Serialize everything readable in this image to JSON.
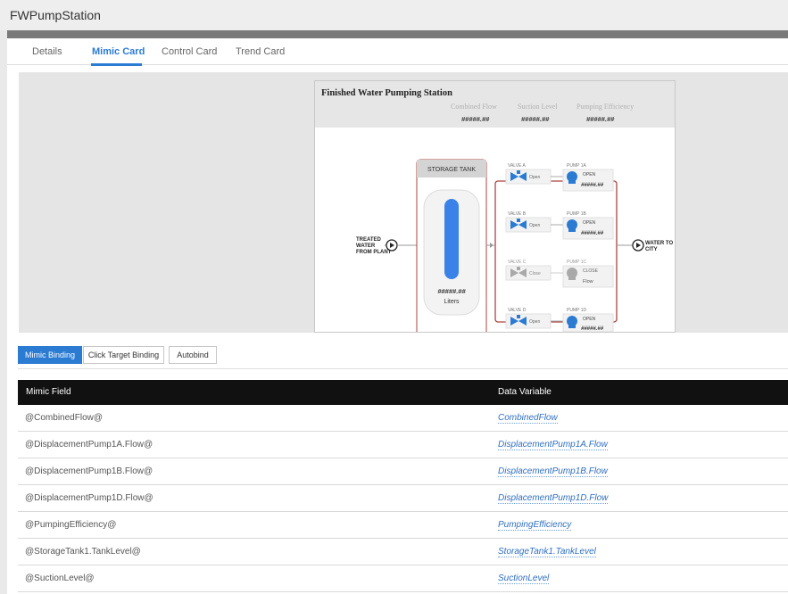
{
  "window": {
    "title": "FWPumpStation"
  },
  "tabs": [
    {
      "label": "Details"
    },
    {
      "label": "Mimic Card"
    },
    {
      "label": "Control Card"
    },
    {
      "label": "Trend Card"
    }
  ],
  "active_tab": "Mimic Card",
  "mimic": {
    "title": "Finished Water Pumping Station",
    "metrics": [
      {
        "label": "Combined Flow",
        "value": "#####.##"
      },
      {
        "label": "Suction Level",
        "value": "#####.##"
      },
      {
        "label": "Pumping Efficiency",
        "value": "#####.##"
      }
    ],
    "tank_label": "STORAGE TANK",
    "tank_value": "#####.##",
    "tank_unit": "Liters",
    "inlet_label": [
      "TREATED",
      "WATER",
      "FROM PLANT"
    ],
    "outlet_label": [
      "WATER TO",
      "CITY"
    ],
    "valves": [
      {
        "name": "VALVE A",
        "state": "Open"
      },
      {
        "name": "VALVE B",
        "state": "Open"
      },
      {
        "name": "VALVE C",
        "state": "Close"
      },
      {
        "name": "VALVE D",
        "state": "Open"
      }
    ],
    "pumps": [
      {
        "name": "PUMP 1A",
        "state": "OPEN",
        "value": "#####.##"
      },
      {
        "name": "PUMP 1B",
        "state": "OPEN",
        "value": "#####.##"
      },
      {
        "name": "PUMP 1C",
        "state": "CLOSE",
        "value": "Flow"
      },
      {
        "name": "PUMP 1D",
        "state": "OPEN",
        "value": "#####.##"
      }
    ],
    "colors": {
      "tank_fill": "#3b82e8",
      "pump_active": "#2b7bd3",
      "pump_inactive": "#a9a9a9",
      "pipe_frame": "#a94442",
      "header_bg": "#e6e6e6"
    }
  },
  "binding_tabs": [
    {
      "label": "Mimic Binding"
    },
    {
      "label": "Click Target Binding"
    },
    {
      "label": "Autobind"
    }
  ],
  "active_binding_tab": "Mimic Binding",
  "table": {
    "headers": {
      "field": "Mimic Field",
      "variable": "Data Variable"
    },
    "rows": [
      {
        "field": "@CombinedFlow@",
        "variable": "CombinedFlow"
      },
      {
        "field": "@DisplacementPump1A.Flow@",
        "variable": "DisplacementPump1A.Flow"
      },
      {
        "field": "@DisplacementPump1B.Flow@",
        "variable": "DisplacementPump1B.Flow"
      },
      {
        "field": "@DisplacementPump1D.Flow@",
        "variable": "DisplacementPump1D.Flow"
      },
      {
        "field": "@PumpingEfficiency@",
        "variable": "PumpingEfficiency"
      },
      {
        "field": "@StorageTank1.TankLevel@",
        "variable": "StorageTank1.TankLevel"
      },
      {
        "field": "@SuctionLevel@",
        "variable": "SuctionLevel"
      }
    ]
  }
}
